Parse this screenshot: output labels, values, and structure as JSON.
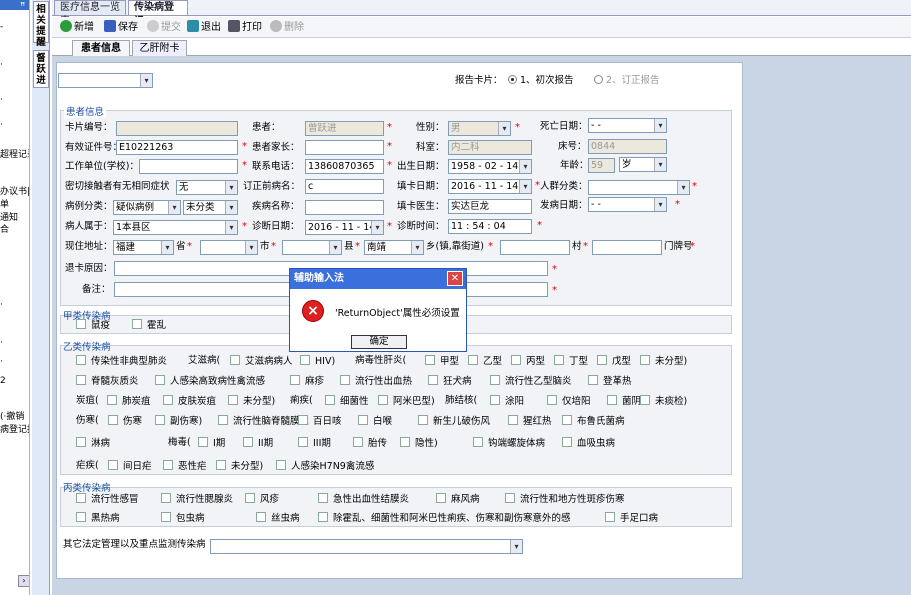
{
  "left_pane": {
    "header": "ꟸ",
    "lines": [
      "-",
      "·",
      "·",
      "·",
      "超程记录",
      "办议书|",
      "单",
      "通知",
      "合",
      "·",
      "·",
      "·",
      "2",
      "(·撤销",
      "病登记报"
    ],
    "scroll_arrow": "›"
  },
  "vertical_tabs": [
    "相关提醒",
    "督跃进"
  ],
  "top_tabs": [
    "医疗信息一览表",
    "传染病登记"
  ],
  "toolbar": {
    "new": "新增",
    "save": "保存",
    "submit": "提交",
    "exit": "退出",
    "print": "打印",
    "delete": "删除"
  },
  "sub_tabs": [
    "患者信息",
    "乙肝附卡"
  ],
  "report": {
    "label": "报告卡片：",
    "opt1": "1、初次报告",
    "opt2": "2、订正报告"
  },
  "patient": {
    "section": "患者信息",
    "card_no_label": "卡片编号：",
    "patient_label": "患者：",
    "patient_value": "曾跃进",
    "sex_label": "性别：",
    "sex_value": "男",
    "death_label": "死亡日期：",
    "death_value": "-  -",
    "id_label": "有效证件号：",
    "id_value": "E10221263",
    "parent_label": "患者家长：",
    "dept_label": "科室：",
    "dept_value": "内二科",
    "bed_label": "床号：",
    "bed_value": "0844",
    "work_label": "工作单位(学校)：",
    "phone_label": "联系电话：",
    "phone_value": "13860870365",
    "birth_label": "出生日期：",
    "birth_value": "1958 - 02 - 14",
    "age_label": "年龄：",
    "age_value": "59",
    "age_unit": "岁",
    "contact_label": "密切接触者有无相同症状",
    "contact_value": "无",
    "corrected_label": "订正前病名：",
    "corrected_value": "c",
    "fill_date_label": "填卡日期：",
    "fill_date_value": "2016 - 11 - 14",
    "crowd_label": "人群分类：",
    "case_label": "病例分类：",
    "case_value1": "疑似病例",
    "case_value2": "未分类",
    "disease_label": "疾病名称：",
    "doctor_label": "填卡医生：",
    "doctor_value": "实达巨龙",
    "onset_label": "发病日期：",
    "onset_value": "-  -",
    "belong_label": "病人属于：",
    "belong_value": "1本县区",
    "diag_date_label": "诊断日期：",
    "diag_date_value": "2016 - 11 - 14",
    "diag_time_label": "诊断时间：",
    "diag_time_value": "11 : 54 : 04",
    "addr_label": "现住地址：",
    "addr_province": "福建",
    "prov_suffix": "省",
    "city_suffix": "市",
    "county_suffix": "县",
    "county_value": "南靖",
    "town_suffix": "乡(镇,靠街道)",
    "village_suffix": "村",
    "house_suffix": "门牌号",
    "cancel_label": "退卡原因：",
    "remark_label": "备注："
  },
  "classA": {
    "title": "甲类传染病",
    "items": [
      "鼠疫",
      "霍乱"
    ]
  },
  "classB": {
    "title": "乙类传染病",
    "row1": [
      "传染性非典型肺炎",
      "艾滋病(",
      "艾滋病病人",
      "HIV)",
      "病毒性肝炎(",
      "甲型",
      "乙型",
      "丙型",
      "丁型",
      "戊型",
      "未分型)"
    ],
    "row2": [
      "脊髓灰质炎",
      "人感染高致病性禽流感",
      "麻疹",
      "流行性出血热",
      "狂犬病",
      "流行性乙型脑炎",
      "登革热"
    ],
    "row3_anthrax": "炭疽(",
    "row3": [
      "肺炭疽",
      "皮肤炭疽",
      "未分型)"
    ],
    "row3_dys": "痢疾(",
    "row3b": [
      "细菌性",
      "阿米巴型)"
    ],
    "row3_tb": "肺结核(",
    "row3c": [
      "涂阳",
      "仅培阳",
      "菌阴",
      "未痰检)"
    ],
    "row4_typhoid": "伤寒(",
    "row4": [
      "伤寒",
      "副伤寒)",
      "流行性脑脊髓膜炎",
      "百日咳",
      "白喉",
      "新生儿破伤风",
      "猩红热",
      "布鲁氏菌病"
    ],
    "row5": [
      "淋病"
    ],
    "row5_syph": "梅毒(",
    "row5b": [
      "I期",
      "II期",
      "III期",
      "胎传",
      "隐性)",
      "钩端螺旋体病",
      "血吸虫病"
    ],
    "row6_mal": "疟疾(",
    "row6": [
      "间日疟",
      "恶性疟",
      "未分型)",
      "人感染H7N9禽流感"
    ]
  },
  "classC": {
    "title": "丙类传染病",
    "row1": [
      "流行性感冒",
      "流行性腮腺炎",
      "风疹",
      "急性出血性结膜炎",
      "麻风病",
      "流行性和地方性斑疹伤寒"
    ],
    "row2": [
      "黑热病",
      "包虫病",
      "丝虫病",
      "除霍乱、细菌性和阿米巴性痢疾、伤寒和副伤寒意外的感",
      "手足口病"
    ]
  },
  "other_label": "其它法定管理以及重点监测传染病",
  "dialog": {
    "title": "辅助输入法",
    "message": "'ReturnObject'属性必须设置",
    "ok": "确定",
    "icon": "×",
    "close": "✕"
  }
}
